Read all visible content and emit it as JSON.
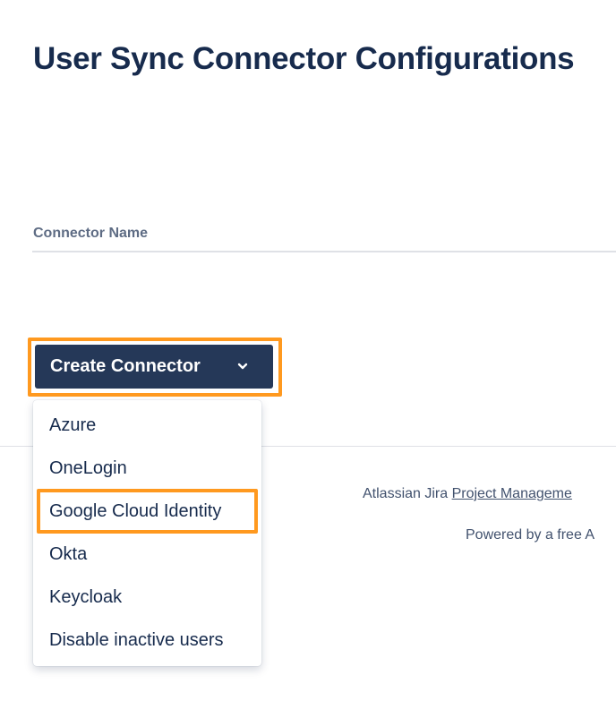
{
  "page": {
    "title": "User Sync Connector Configurations"
  },
  "table": {
    "column_header": "Connector Name"
  },
  "create_button": {
    "label": "Create Connector",
    "icon": "chevron-down-icon",
    "highlighted": true
  },
  "dropdown": {
    "items": [
      {
        "label": "Azure"
      },
      {
        "label": "OneLogin"
      },
      {
        "label": "Google Cloud Identity"
      },
      {
        "label": "Okta"
      },
      {
        "label": "Keycloak"
      },
      {
        "label": "Disable inactive users"
      }
    ],
    "highlighted_item": "Google Cloud Identity"
  },
  "footer": {
    "line1_prefix": "Atlassian Jira ",
    "line1_link": "Project Manageme",
    "line2": "Powered by a free A"
  },
  "colors": {
    "button_bg": "#253858",
    "highlight": "#ff991f",
    "title": "#172b4d",
    "muted_text": "#5e6c84"
  }
}
